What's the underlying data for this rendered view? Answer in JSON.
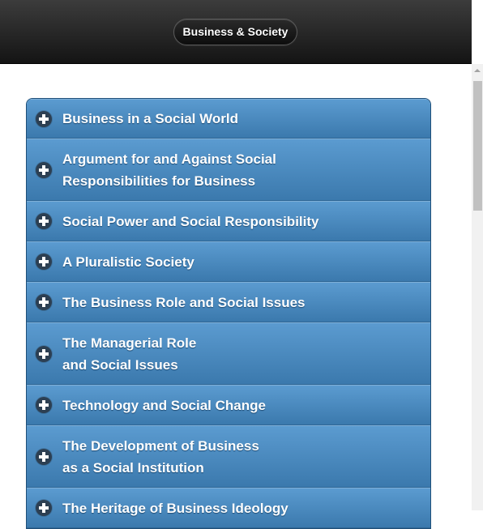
{
  "header": {
    "title": "Business & Society"
  },
  "topics": [
    {
      "label": "Business in a Social World",
      "icon": "plus-circle-icon"
    },
    {
      "label": "Argument for and Against Social\nResponsibilities for Business",
      "icon": "plus-circle-icon"
    },
    {
      "label": "Social Power and Social Responsibility",
      "icon": "plus-circle-icon"
    },
    {
      "label": "A Pluralistic Society",
      "icon": "plus-circle-icon"
    },
    {
      "label": "The Business Role and Social Issues",
      "icon": "plus-circle-icon"
    },
    {
      "label": "The Managerial Role\nand Social Issues",
      "icon": "plus-circle-icon"
    },
    {
      "label": "Technology and Social Change",
      "icon": "plus-circle-icon"
    },
    {
      "label": "The Development of Business\nas a Social Institution",
      "icon": "plus-circle-icon"
    },
    {
      "label": "The Heritage of Business Ideology",
      "icon": "plus-circle-icon"
    }
  ],
  "colors": {
    "header_bg": "#1e1e1e",
    "item_bg_top": "#5b9bd0",
    "item_bg_bottom": "#3b79ad",
    "icon_bg": "#2c3f52"
  }
}
